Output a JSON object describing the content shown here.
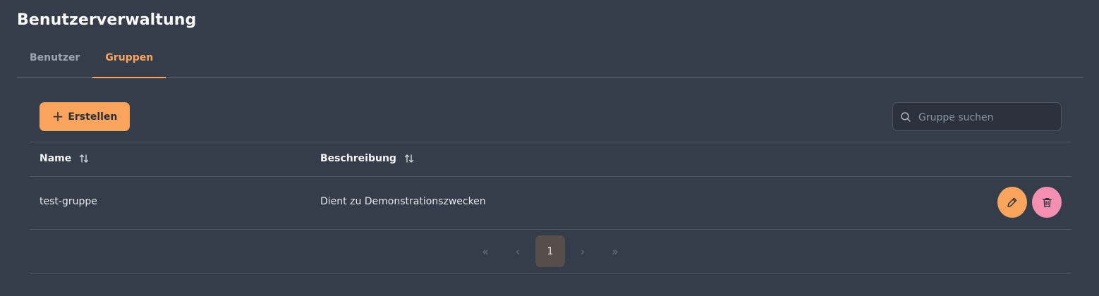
{
  "page": {
    "title": "Benutzerverwaltung"
  },
  "tabs": [
    {
      "label": "Benutzer",
      "active": false
    },
    {
      "label": "Gruppen",
      "active": true
    }
  ],
  "toolbar": {
    "create_label": "Erstellen",
    "search_placeholder": "Gruppe suchen",
    "search_value": ""
  },
  "table": {
    "columns": [
      "Name",
      "Beschreibung"
    ],
    "rows": [
      {
        "name": "test-gruppe",
        "description": "Dient zu Demonstrationszwecken"
      }
    ]
  },
  "pagination": {
    "first": "«",
    "prev": "‹",
    "current": "1",
    "next": "›",
    "last": "»"
  },
  "colors": {
    "accent": "#fba45e",
    "danger": "#f48fb1",
    "background": "#353d4a"
  },
  "icons": [
    "plus-icon",
    "search-icon",
    "sort-icon",
    "pencil-icon",
    "trash-icon"
  ]
}
